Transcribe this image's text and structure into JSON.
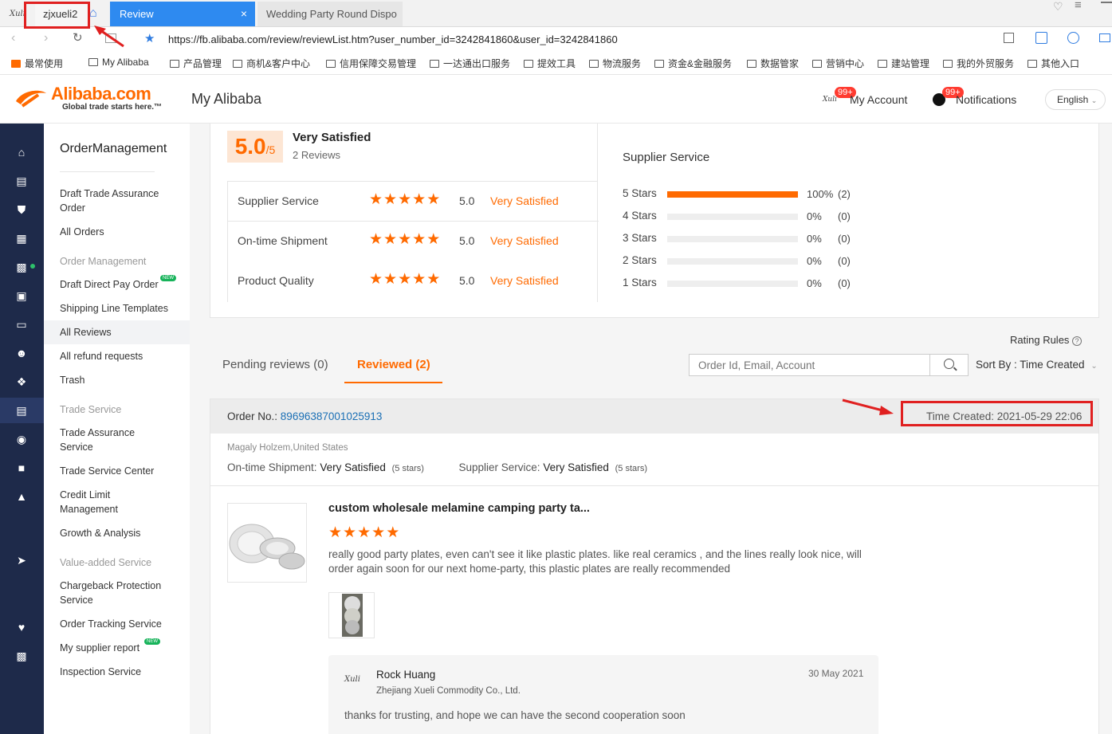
{
  "browser": {
    "tabs": [
      {
        "label": "zjxueli2"
      },
      {
        "label": "Review"
      },
      {
        "label": "Wedding Party Round Dispo"
      }
    ],
    "url": "https://fb.alibaba.com/review/reviewList.htm?user_number_id=3242841860&user_id=3242841860",
    "bookmarks": [
      "最常使用",
      "My Alibaba",
      "产品管理",
      "商机&客户中心",
      "信用保障交易管理",
      "一达通出口服务",
      "提效工具",
      "物流服务",
      "资金&金融服务",
      "数据管家",
      "营销中心",
      "建站管理",
      "我的外贸服务",
      "其他入口"
    ]
  },
  "header": {
    "logo_text": "Alibaba.com",
    "logo_tagline": "Global trade starts here.™",
    "page_title": "My Alibaba",
    "account_label": "My Account",
    "account_badge": "99+",
    "notifications_label": "Notifications",
    "notifications_badge": "99+",
    "language": "English"
  },
  "sidebar": {
    "title": "OrderManagement",
    "items": [
      "Draft Trade Assurance Order",
      "All Orders"
    ],
    "group1_header": "Order Management",
    "group1": [
      "Draft Direct Pay Order",
      "Shipping Line Templates",
      "All Reviews",
      "All refund requests",
      "Trash"
    ],
    "group2_header": "Trade Service",
    "group2": [
      "Trade Assurance Service",
      "Trade Service Center",
      "Credit Limit Management",
      "Growth & Analysis"
    ],
    "group3_header": "Value-added Service",
    "group3": [
      "Chargeback Protection Service",
      "Order Tracking Service",
      "My supplier report",
      "Inspection Service"
    ],
    "new_badge": "NEW"
  },
  "summary": {
    "score": "5.0",
    "score_max": "/5",
    "rating_text": "Very Satisfied",
    "reviews_count": "2 Reviews",
    "rows": [
      {
        "label": "Supplier Service",
        "stars": 5,
        "value": "5.0",
        "text": "Very Satisfied"
      },
      {
        "label": "On-time Shipment",
        "stars": 5,
        "value": "5.0",
        "text": "Very Satisfied"
      },
      {
        "label": "Product Quality",
        "stars": 5,
        "value": "5.0",
        "text": "Very Satisfied"
      }
    ],
    "distribution_title": "Supplier Service",
    "distribution": [
      {
        "label": "5 Stars",
        "pct": "100%",
        "count": "(2)",
        "fraction": 1
      },
      {
        "label": "4 Stars",
        "pct": "0%",
        "count": "(0)",
        "fraction": 0
      },
      {
        "label": "3 Stars",
        "pct": "0%",
        "count": "(0)",
        "fraction": 0
      },
      {
        "label": "2 Stars",
        "pct": "0%",
        "count": "(0)",
        "fraction": 0
      },
      {
        "label": "1 Stars",
        "pct": "0%",
        "count": "(0)",
        "fraction": 0
      }
    ]
  },
  "controls": {
    "rating_rules": "Rating Rules",
    "tab_pending": "Pending reviews (0)",
    "tab_reviewed": "Reviewed (2)",
    "search_placeholder": "Order Id, Email, Account",
    "sort_label": "Sort By : Time Created"
  },
  "order": {
    "order_no_label": "Order No.:",
    "order_no": "89696387001025913",
    "time_created": "Time Created: 2021-05-29 22:06",
    "buyer": "Magaly Holzem,United States",
    "ontime_label": "On-time Shipment:",
    "ontime_value": "Very Satisfied",
    "ontime_stars": "(5 stars)",
    "supplier_label": "Supplier Service:",
    "supplier_value": "Very Satisfied",
    "supplier_stars": "(5 stars)",
    "product_title": "custom wholesale melamine camping party ta...",
    "product_stars": 5,
    "review_text": "really good party plates, even can't see it like plastic plates. like real ceramics , and the lines really look nice, will order again soon for our next home-party,  this plastic plates are really recommended",
    "reply_name": "Rock Huang",
    "reply_company": "Zhejiang Xueli Commodity Co., Ltd.",
    "reply_date": "30 May 2021",
    "reply_text": "thanks for trusting, and hope we can have the second cooperation soon"
  },
  "colors": {
    "accent": "#ff6a00",
    "link": "#1a6fb5",
    "rail": "#1e2a4a",
    "annotation": "#e02020"
  }
}
